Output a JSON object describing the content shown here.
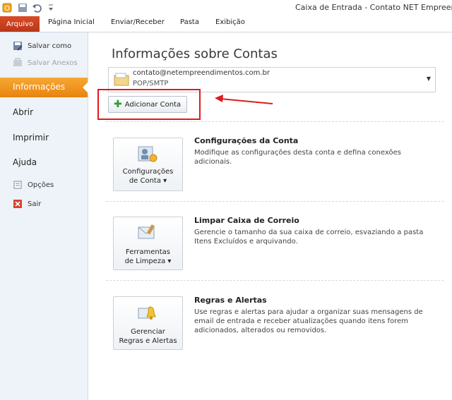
{
  "window": {
    "title": "Caixa de Entrada - Contato   NET Empreendim"
  },
  "ribbon": {
    "tabs": [
      "Arquivo",
      "Página Inicial",
      "Enviar/Receber",
      "Pasta",
      "Exibição"
    ]
  },
  "leftnav": {
    "save_as": "Salvar como",
    "save_attachments": "Salvar Anexos",
    "info": "Informações",
    "open": "Abrir",
    "print": "Imprimir",
    "help": "Ajuda",
    "options": "Opções",
    "exit": "Sair"
  },
  "main": {
    "title": "Informações sobre Contas",
    "account": {
      "email": "contato@netempreendimentos.com.br",
      "type": "POP/SMTP"
    },
    "add_account_label": "Adicionar Conta",
    "sections": [
      {
        "button_line1": "Configurações",
        "button_line2": "de Conta ▾",
        "title": "Configurações da Conta",
        "description": "Modifique as configurações desta conta e defina conexões adicionais."
      },
      {
        "button_line1": "Ferramentas",
        "button_line2": "de Limpeza ▾",
        "title": "Limpar Caixa de Correio",
        "description": "Gerencie o tamanho da sua caixa de correio, esvaziando a pasta Itens Excluídos e arquivando."
      },
      {
        "button_line1": "Gerenciar",
        "button_line2": "Regras e Alertas",
        "title": "Regras e Alertas",
        "description": "Use regras e alertas para ajudar a organizar suas mensagens de email de entrada e receber atualizações quando itens forem adicionados, alterados ou removidos."
      }
    ]
  },
  "colors": {
    "arquivo_tab": "#c0392b",
    "info_highlight": "#f0961e",
    "annotation_red": "#e01a1a"
  },
  "icons": [
    "outlook-icon",
    "save-icon",
    "undo-icon",
    "customize-icon",
    "save-as-icon",
    "attachment-icon",
    "options-icon",
    "exit-icon",
    "mail-folder-icon",
    "dropdown-arrow-icon",
    "plus-icon",
    "account-settings-icon",
    "cleanup-icon",
    "rules-alerts-icon"
  ]
}
